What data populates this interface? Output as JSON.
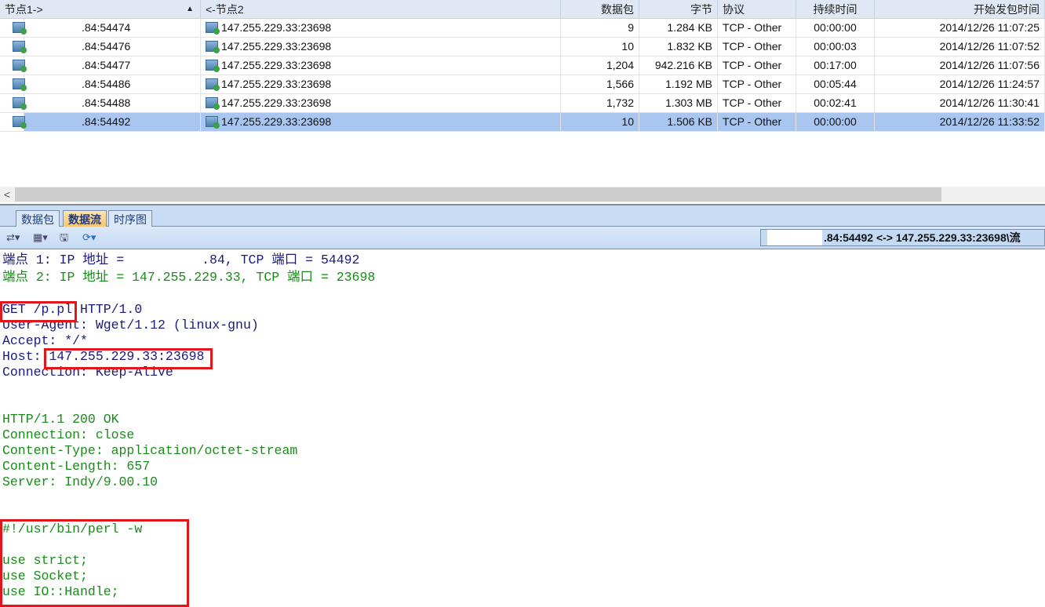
{
  "table": {
    "columns": [
      "节点1->",
      "<-节点2",
      "数据包",
      "字节",
      "协议",
      "持续时间",
      "开始发包时间"
    ],
    "sort_indicator": "▲",
    "rows": [
      {
        "node1": ".84:54474",
        "node2": "147.255.229.33:23698",
        "packets": "9",
        "bytes": "1.284 KB",
        "protocol": "TCP - Other",
        "duration": "00:00:00",
        "start": "2014/12/26 11:07:25"
      },
      {
        "node1": ".84:54476",
        "node2": "147.255.229.33:23698",
        "packets": "10",
        "bytes": "1.832 KB",
        "protocol": "TCP - Other",
        "duration": "00:00:03",
        "start": "2014/12/26 11:07:52"
      },
      {
        "node1": ".84:54477",
        "node2": "147.255.229.33:23698",
        "packets": "1,204",
        "bytes": "942.216 KB",
        "protocol": "TCP - Other",
        "duration": "00:17:00",
        "start": "2014/12/26 11:07:56"
      },
      {
        "node1": ".84:54486",
        "node2": "147.255.229.33:23698",
        "packets": "1,566",
        "bytes": "1.192 MB",
        "protocol": "TCP - Other",
        "duration": "00:05:44",
        "start": "2014/12/26 11:24:57"
      },
      {
        "node1": ".84:54488",
        "node2": "147.255.229.33:23698",
        "packets": "1,732",
        "bytes": "1.303 MB",
        "protocol": "TCP - Other",
        "duration": "00:02:41",
        "start": "2014/12/26 11:30:41"
      },
      {
        "node1": ".84:54492",
        "node2": "147.255.229.33:23698",
        "packets": "10",
        "bytes": "1.506 KB",
        "protocol": "TCP - Other",
        "duration": "00:00:00",
        "start": "2014/12/26 11:33:52"
      }
    ]
  },
  "tabs": [
    "数据包",
    "数据流",
    "时序图"
  ],
  "active_tab": "数据流",
  "address": ".84:54492 <-> 147.255.229.33:23698\\流",
  "stream": {
    "lines": [
      {
        "c": "b",
        "t": "端点 1: IP 地址 =          .84, TCP 端口 = 54492"
      },
      {
        "c": "g",
        "t": "端点 2: IP 地址 = 147.255.229.33, TCP 端口 = 23698"
      },
      {
        "c": "b",
        "t": ""
      },
      {
        "c": "b",
        "t": "GET /p.pl HTTP/1.0"
      },
      {
        "c": "b",
        "t": "User-Agent: Wget/1.12 (linux-gnu)"
      },
      {
        "c": "b",
        "t": "Accept: */*"
      },
      {
        "c": "b",
        "t": "Host: 147.255.229.33:23698"
      },
      {
        "c": "b",
        "t": "Connection: Keep-Alive"
      },
      {
        "c": "b",
        "t": ""
      },
      {
        "c": "b",
        "t": ""
      },
      {
        "c": "g",
        "t": "HTTP/1.1 200 OK"
      },
      {
        "c": "g",
        "t": "Connection: close"
      },
      {
        "c": "g",
        "t": "Content-Type: application/octet-stream"
      },
      {
        "c": "g",
        "t": "Content-Length: 657"
      },
      {
        "c": "g",
        "t": "Server: Indy/9.00.10"
      },
      {
        "c": "g",
        "t": ""
      },
      {
        "c": "g",
        "t": ""
      },
      {
        "c": "g",
        "t": "#!/usr/bin/perl -w"
      },
      {
        "c": "g",
        "t": ""
      },
      {
        "c": "g",
        "t": "use strict;"
      },
      {
        "c": "g",
        "t": "use Socket;"
      },
      {
        "c": "g",
        "t": "use IO::Handle;"
      }
    ]
  }
}
